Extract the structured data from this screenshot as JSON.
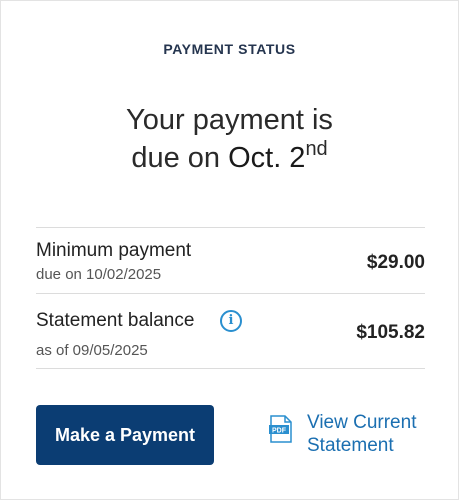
{
  "payment_status": {
    "title": "PAYMENT STATUS",
    "headline_line1": "Your payment is",
    "headline_due_prefix": "due on ",
    "headline_date": "Oct. 2",
    "headline_date_suffix": "nd"
  },
  "minimum_payment": {
    "label": "Minimum payment",
    "sub": "due on 10/02/2025",
    "amount": "$29.00"
  },
  "statement_balance": {
    "label": "Statement balance",
    "sub": "as of 09/05/2025",
    "amount": "$105.82",
    "info_icon": "i"
  },
  "actions": {
    "make_payment": "Make a Payment",
    "view_statement": "View Current Statement",
    "pdf_badge": "PDF"
  },
  "colors": {
    "primary_button": "#0b3d73",
    "link": "#1b6fb1",
    "info_icon": "#2a8fcf"
  },
  "icons": {
    "info": "info-circle-icon",
    "statement": "pdf-document-icon"
  }
}
